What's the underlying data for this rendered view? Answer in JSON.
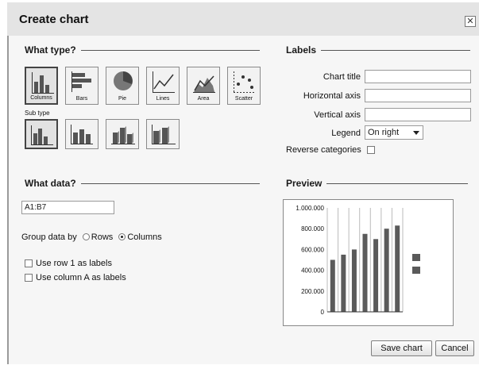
{
  "dialog": {
    "title": "Create chart",
    "close_glyph": "✕"
  },
  "what_type": {
    "heading": "What type?",
    "types": [
      {
        "label": "Columns",
        "icon": "columns-chart-icon",
        "selected": true
      },
      {
        "label": "Bars",
        "icon": "bars-chart-icon",
        "selected": false
      },
      {
        "label": "Pie",
        "icon": "pie-chart-icon",
        "selected": false
      },
      {
        "label": "Lines",
        "icon": "lines-chart-icon",
        "selected": false
      },
      {
        "label": "Area",
        "icon": "area-chart-icon",
        "selected": false
      },
      {
        "label": "Scatter",
        "icon": "scatter-chart-icon",
        "selected": false
      }
    ],
    "subtype_label": "Sub type",
    "subtypes": [
      {
        "icon": "clustered-columns-icon",
        "selected": true
      },
      {
        "icon": "stacked-columns-icon",
        "selected": false
      },
      {
        "icon": "3d-clustered-columns-icon",
        "selected": false
      },
      {
        "icon": "3d-stacked-columns-icon",
        "selected": false
      }
    ]
  },
  "labels": {
    "heading": "Labels",
    "chart_title_label": "Chart title",
    "chart_title_value": "",
    "horizontal_axis_label": "Horizontal axis",
    "horizontal_axis_value": "",
    "vertical_axis_label": "Vertical axis",
    "vertical_axis_value": "",
    "legend_label": "Legend",
    "legend_value": "On right",
    "reverse_label": "Reverse categories",
    "reverse_checked": false
  },
  "what_data": {
    "heading": "What data?",
    "range_value": "A1:B7",
    "group_by_label": "Group data by",
    "rows_label": "Rows",
    "columns_label": "Columns",
    "group_by_selected": "Columns",
    "use_row1_label": "Use row 1 as labels",
    "use_row1_checked": false,
    "use_colA_label": "Use column A as labels",
    "use_colA_checked": false
  },
  "preview": {
    "heading": "Preview"
  },
  "chart_data": {
    "type": "bar",
    "yticks": [
      "1.000.000",
      "800.000",
      "600.000",
      "400.000",
      "200.000",
      "0"
    ],
    "ylim": [
      0,
      1000000
    ],
    "values": [
      500000,
      550000,
      600000,
      750000,
      700000,
      800000,
      830000
    ],
    "bar_color": "#5a5a5a",
    "legend_swatch_color": "#5a5a5a"
  },
  "buttons": {
    "save_label": "Save chart",
    "cancel_label": "Cancel"
  }
}
